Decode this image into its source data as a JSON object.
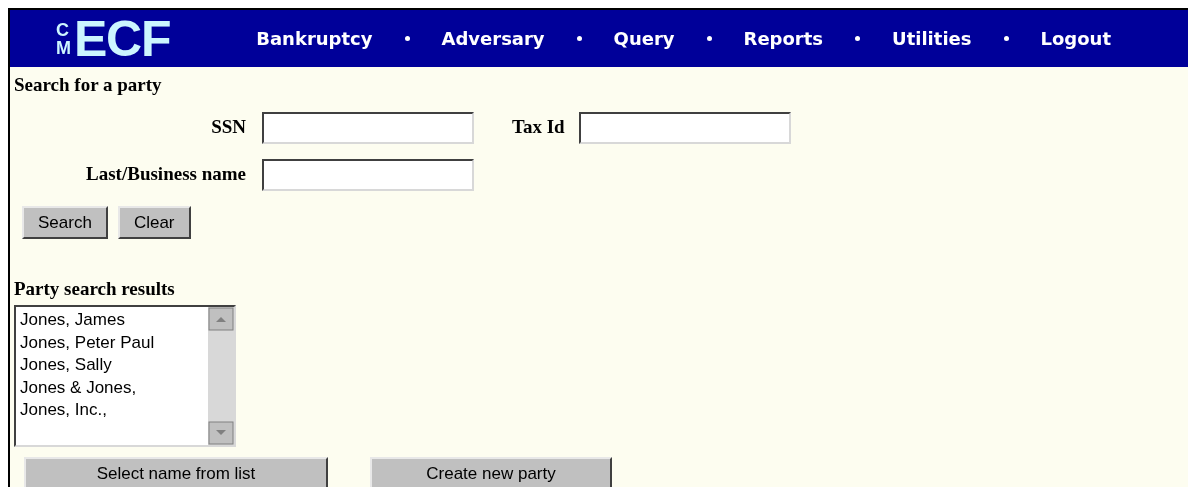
{
  "logo": {
    "small": "CM",
    "large": "ECF"
  },
  "nav": [
    {
      "label": "Bankruptcy"
    },
    {
      "label": "Adversary"
    },
    {
      "label": "Query"
    },
    {
      "label": "Reports"
    },
    {
      "label": "Utilities"
    },
    {
      "label": "Logout"
    }
  ],
  "search_heading": "Search for a party",
  "fields": {
    "ssn": {
      "label": "SSN"
    },
    "tax_id": {
      "label": "Tax Id"
    },
    "last_name": {
      "label": "Last/Business name"
    }
  },
  "buttons": [
    "Search",
    "Clear"
  ],
  "results_heading": "Party search results",
  "results": [
    "Jones, James",
    "Jones, Peter Paul",
    "Jones, Sally",
    "Jones & Jones,",
    "Jones, Inc.,"
  ],
  "actions": [
    "Select name from list",
    "Create new party"
  ]
}
